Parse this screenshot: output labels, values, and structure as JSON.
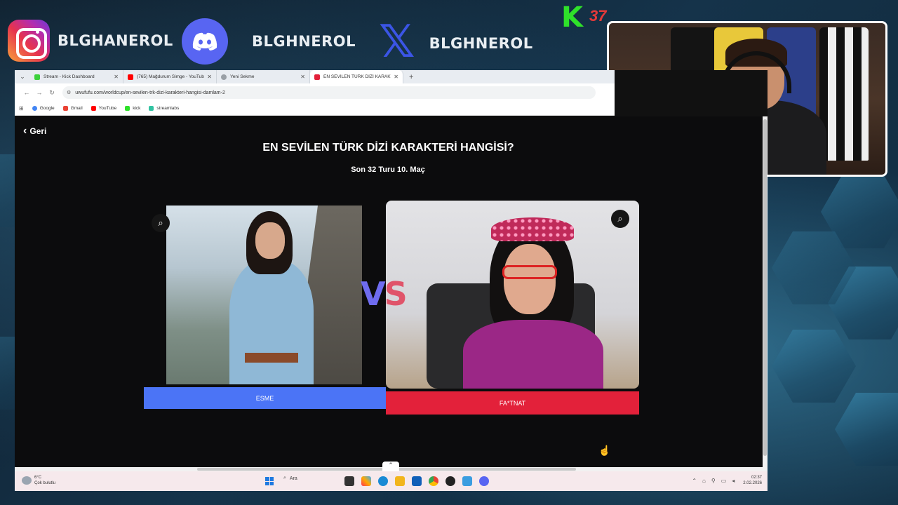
{
  "overlay": {
    "socials": [
      {
        "platform": "instagram",
        "icon": "instagram-icon",
        "handle": "BLGHANEROL"
      },
      {
        "platform": "discord",
        "icon": "discord-icon",
        "handle": "BLGHNEROL"
      },
      {
        "platform": "x",
        "icon": "x-icon",
        "handle": "BLGHNEROL"
      }
    ],
    "kick_logo": "K",
    "kick_number": "37"
  },
  "browser": {
    "tabs": [
      {
        "label": "Stream - Kick Dashboard",
        "icon": "kick-favicon",
        "active": false
      },
      {
        "label": "(765) Mağdurum Simge - YouTube",
        "icon": "youtube-favicon",
        "active": false
      },
      {
        "label": "Yeni Sekme",
        "icon": "chrome-favicon",
        "active": false
      },
      {
        "label": "EN SEVİLEN TÜRK DİZİ KARAKT",
        "icon": "uwufufu-favicon",
        "active": true
      }
    ],
    "url": "uwufufu.com/worldcup/en-sevilen-trk-dizi-karakteri-hangisi-damlam-2",
    "bookmarks": [
      {
        "label": "Google",
        "icon": "google-icon"
      },
      {
        "label": "Gmail",
        "icon": "gmail-icon"
      },
      {
        "label": "YouTube",
        "icon": "youtube-icon"
      },
      {
        "label": "kick",
        "icon": "kick-icon"
      },
      {
        "label": "streamlabs",
        "icon": "streamlabs-icon"
      }
    ]
  },
  "page": {
    "back_label": "Geri",
    "title": "EN SEVİLEN TÜRK DİZİ KARAKTERİ HANGİSİ?",
    "subtitle": "Son 32 Turu 10. Maç",
    "vs_v": "V",
    "vs_s": "S",
    "left_choice": "ESME",
    "right_choice": "FA*TNAT"
  },
  "taskbar": {
    "weather_temp": "6°C",
    "weather_desc": "Çok bulutlu",
    "search_placeholder": "Ara",
    "time": "02:37",
    "date": "2.02.2026"
  },
  "colors": {
    "left_button": "#4b74f6",
    "right_button": "#e3213a",
    "vs_v": "#6f6cf0",
    "vs_s": "#e0546a"
  }
}
